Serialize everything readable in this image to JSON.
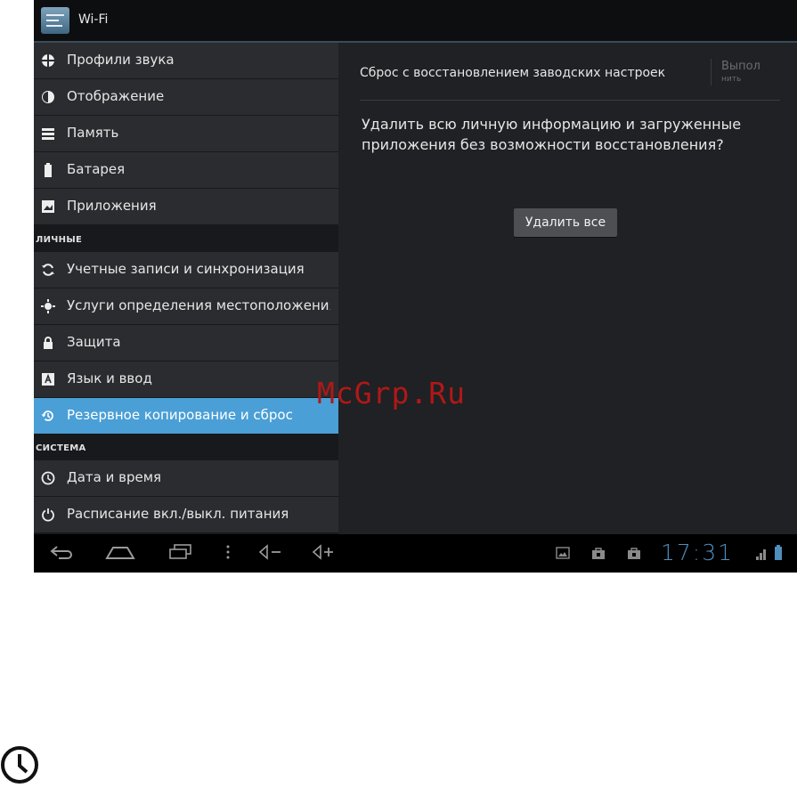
{
  "actionbar": {
    "title": "Wi-Fi"
  },
  "settings_list": {
    "items": [
      {
        "label": "Профили звука",
        "icon": "sound-profile-icon"
      },
      {
        "label": "Отображение",
        "icon": "display-icon"
      },
      {
        "label": "Память",
        "icon": "storage-icon"
      },
      {
        "label": "Батарея",
        "icon": "battery-icon"
      },
      {
        "label": "Приложения",
        "icon": "apps-icon"
      }
    ],
    "section_personal": "ЛИЧНЫЕ",
    "personal_items": [
      {
        "label": "Учетные записи и синхронизация",
        "icon": "sync-icon"
      },
      {
        "label": "Услуги определения местоположения",
        "icon": "location-icon"
      },
      {
        "label": "Защита",
        "icon": "lock-icon"
      },
      {
        "label": "Язык и ввод",
        "icon": "language-icon"
      },
      {
        "label": "Резервное копирование и сброс",
        "icon": "backup-icon",
        "selected": true
      }
    ],
    "section_system": "СИСТЕМА",
    "system_items": [
      {
        "label": "Дата и время",
        "icon": "clock-icon"
      },
      {
        "label": "Расписание вкл./выкл. питания",
        "icon": "power-schedule-icon"
      }
    ]
  },
  "detail": {
    "title": "Сброс с восстановлением заводских настроек",
    "action_label": "Выпол",
    "action_label_line2": "нить",
    "message": "Удалить всю личную информацию и загруженные приложения без возможности восстановления?",
    "button": "Удалить все"
  },
  "navbar": {
    "time": "17:31"
  },
  "watermark": "McGrp.Ru",
  "colors": {
    "selected": "#4a9fd6",
    "background": "#1f2124",
    "list_item": "#2a2c2f"
  }
}
